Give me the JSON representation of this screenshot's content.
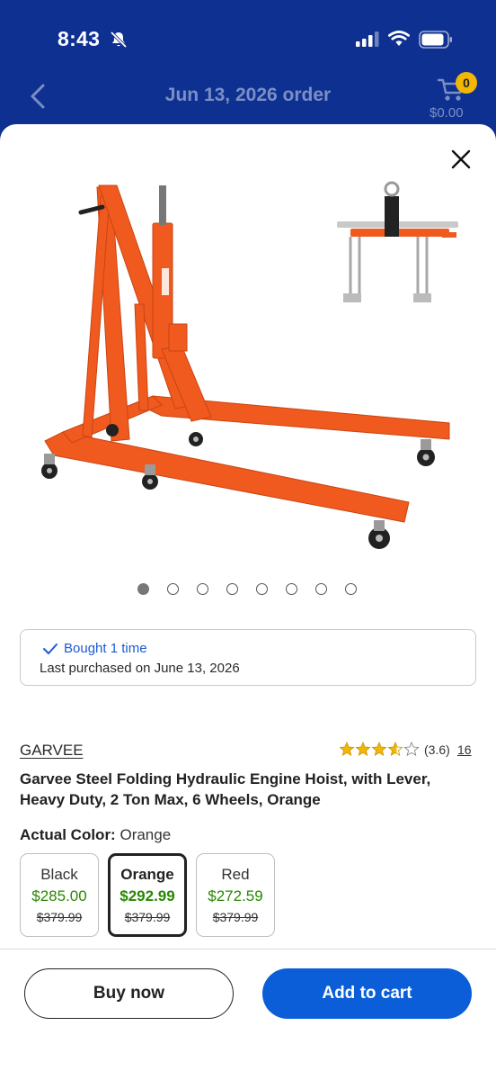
{
  "status": {
    "time": "8:43"
  },
  "header": {
    "title": "Jun 13, 2026 order",
    "cart_count": "0",
    "cart_total": "$0.00"
  },
  "gallery": {
    "image_count": 8,
    "active_index": 0
  },
  "purchase_history": {
    "headline": "Bought 1 time",
    "last_purchased": "Last purchased on June 13, 2026"
  },
  "product": {
    "brand": "GARVEE",
    "rating": 3.6,
    "rating_text": "(3.6)",
    "review_count": "16",
    "title": "Garvee Steel Folding Hydraulic Engine Hoist, with Lever, Heavy Duty, 2 Ton Max, 6 Wheels, Orange",
    "color_label": "Actual Color:",
    "color_value": "Orange"
  },
  "variants": [
    {
      "name": "Black",
      "price": "$285.00",
      "was": "$379.99",
      "selected": false
    },
    {
      "name": "Orange",
      "price": "$292.99",
      "was": "$379.99",
      "selected": true
    },
    {
      "name": "Red",
      "price": "$272.59",
      "was": "$379.99",
      "selected": false
    }
  ],
  "actions": {
    "buy_now": "Buy now",
    "add_to_cart": "Add to cart"
  },
  "colors": {
    "header_bg": "#0e3191",
    "accent_blue": "#0b5ed7",
    "price_green": "#2a8703",
    "product_orange": "#f05a1f",
    "star_gold": "#f2b705"
  }
}
